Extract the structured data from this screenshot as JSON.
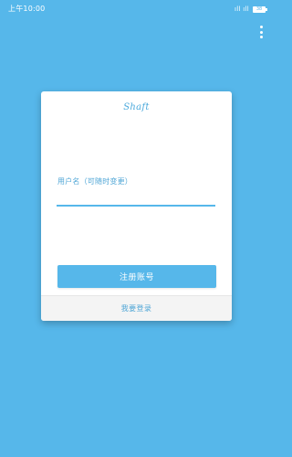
{
  "status_bar": {
    "time": "上午10:00",
    "signal_text": "ıll ıll",
    "battery_level": "38"
  },
  "colors": {
    "background": "#56b7ea",
    "accent": "#56b7ea",
    "accent_text": "#4fa6d6",
    "card": "#ffffff",
    "footer": "#f4f4f4"
  },
  "icons": {
    "menu": "more-vertical-icon",
    "battery": "battery-icon",
    "signal": "signal-icon"
  },
  "card": {
    "brand": "Shaft",
    "username_label": "用户名（可随时变更）",
    "username_value": "",
    "register_button": "注册账号",
    "login_link": "我要登录"
  }
}
